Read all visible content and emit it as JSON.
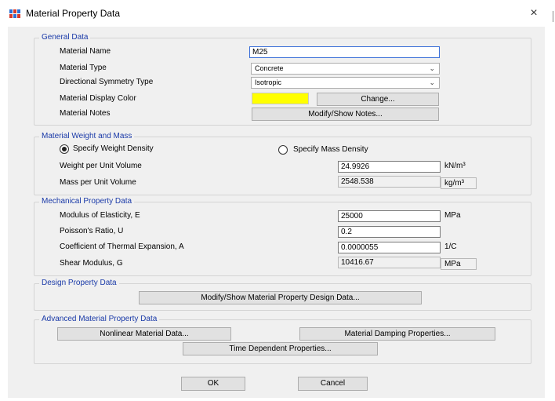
{
  "window": {
    "title": "Material Property Data",
    "close_glyph": "×"
  },
  "general": {
    "title": "General Data",
    "material_name_label": "Material Name",
    "material_name_value": "M25",
    "material_type_label": "Material Type",
    "material_type_value": "Concrete",
    "symmetry_label": "Directional Symmetry Type",
    "symmetry_value": "Isotropic",
    "display_color_label": "Material Display Color",
    "display_color": "#ffff00",
    "change_button": "Change...",
    "notes_label": "Material Notes",
    "notes_button": "Modify/Show Notes..."
  },
  "weight": {
    "title": "Material Weight and Mass",
    "option_weight": "Specify Weight Density",
    "option_mass": "Specify Mass Density",
    "selected": "weight",
    "weight_label": "Weight per Unit Volume",
    "weight_value": "24.9926",
    "weight_unit": "kN/m³",
    "mass_label": "Mass per Unit Volume",
    "mass_value": "2548.538",
    "mass_unit": "kg/m³"
  },
  "mechanical": {
    "title": "Mechanical Property Data",
    "elasticity_label": "Modulus of Elasticity,  E",
    "elasticity_value": "25000",
    "elasticity_unit": "MPa",
    "poisson_label": "Poisson's Ratio,  U",
    "poisson_value": "0.2",
    "thermal_label": "Coefficient of Thermal Expansion,  A",
    "thermal_value": "0.0000055",
    "thermal_unit": "1/C",
    "shear_label": "Shear Modulus,  G",
    "shear_value": "10416.67",
    "shear_unit": "MPa"
  },
  "design": {
    "title": "Design Property Data",
    "button": "Modify/Show Material Property Design Data..."
  },
  "advanced": {
    "title": "Advanced Material Property Data",
    "nonlinear_button": "Nonlinear Material Data...",
    "damping_button": "Material Damping Properties...",
    "time_button": "Time Dependent Properties..."
  },
  "footer": {
    "ok": "OK",
    "cancel": "Cancel"
  },
  "colors": {
    "group_title": "#1a3aa8",
    "swatch": "#ffff00",
    "active_border": "#3a6fd8"
  }
}
